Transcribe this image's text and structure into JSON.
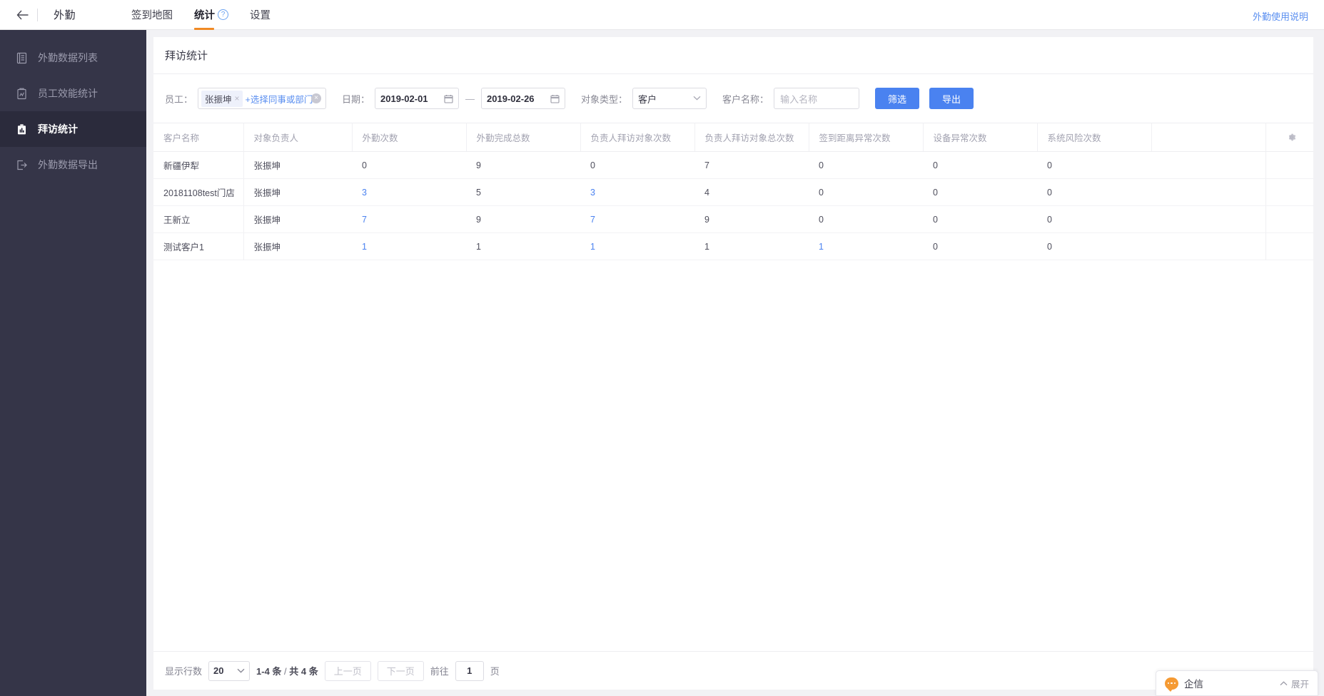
{
  "topbar": {
    "back_icon": "arrow-left-icon",
    "app_title": "外勤",
    "tabs": [
      {
        "label": "签到地图",
        "active": false,
        "help": false
      },
      {
        "label": "统计",
        "active": true,
        "help": true
      },
      {
        "label": "设置",
        "active": false,
        "help": false
      }
    ],
    "help_glyph": "?",
    "right_link": "外勤使用说明",
    "accent_active": "#f08a24",
    "link_color": "#5b8ff0"
  },
  "sidebar": {
    "items": [
      {
        "label": "外勤数据列表",
        "icon": "list-doc-icon",
        "active": false
      },
      {
        "label": "员工效能统计",
        "icon": "chart-clipboard-icon",
        "active": false
      },
      {
        "label": "拜访统计",
        "icon": "bar-chart-icon",
        "active": true
      },
      {
        "label": "外勤数据导出",
        "icon": "export-icon",
        "active": false
      }
    ],
    "bg": "#353548",
    "active_bg": "#2b2b3c"
  },
  "page": {
    "card_title": "拜访统计"
  },
  "filters": {
    "employee_label": "员工：",
    "employee_tags": [
      "张振坤"
    ],
    "employee_tag_close": "×",
    "employee_add": "+选择同事或部门",
    "employee_clear": "×",
    "date_label": "日期：",
    "date_start": "2019-02-01",
    "date_end": "2019-02-26",
    "date_dash": "—",
    "calendar_icon": "calendar-icon",
    "object_type_label": "对象类型：",
    "object_type_value": "客户",
    "object_type_options": [
      "客户"
    ],
    "customer_name_label": "客户名称：",
    "customer_name_value": "",
    "customer_name_placeholder": "输入名称",
    "filter_button": "筛选",
    "export_button": "导出",
    "button_color": "#4a82f0"
  },
  "table": {
    "columns": [
      "客户名称",
      "对象负责人",
      "外勤次数",
      "外勤完成总数",
      "负责人拜访对象次数",
      "负责人拜访对象总次数",
      "签到距离异常次数",
      "设备异常次数",
      "系统风险次数"
    ],
    "settings_icon": "gear-icon",
    "rows": [
      {
        "cells": [
          "新疆伊犁",
          "张振坤",
          "0",
          "9",
          "0",
          "7",
          "0",
          "0",
          "0"
        ],
        "links": [
          false,
          false,
          false,
          false,
          false,
          false,
          false,
          false,
          false
        ]
      },
      {
        "cells": [
          "20181108test门店",
          "张振坤",
          "3",
          "5",
          "3",
          "4",
          "0",
          "0",
          "0"
        ],
        "links": [
          false,
          false,
          true,
          false,
          true,
          false,
          false,
          false,
          false
        ]
      },
      {
        "cells": [
          "王新立",
          "张振坤",
          "7",
          "9",
          "7",
          "9",
          "0",
          "0",
          "0"
        ],
        "links": [
          false,
          false,
          true,
          false,
          true,
          false,
          false,
          false,
          false
        ]
      },
      {
        "cells": [
          "测试客户1",
          "张振坤",
          "1",
          "1",
          "1",
          "1",
          "1",
          "0",
          "0"
        ],
        "links": [
          false,
          false,
          true,
          false,
          true,
          false,
          true,
          false,
          false
        ]
      }
    ],
    "link_color": "#4a82f0"
  },
  "pagination": {
    "rows_label": "显示行数",
    "rows_value": "20",
    "rows_options": [
      "20"
    ],
    "range_bold": "1-4 条",
    "range_sep": " / ",
    "range_total": "共 4 条",
    "prev_label": "上一页",
    "next_label": "下一页",
    "goto_label": "前往",
    "goto_value": "1",
    "page_unit": "页"
  },
  "chat": {
    "icon": "chat-bubble-icon",
    "name": "企信",
    "expand_icon": "chevron-up-icon",
    "expand_label": "展开",
    "brand": "#f59a33"
  }
}
